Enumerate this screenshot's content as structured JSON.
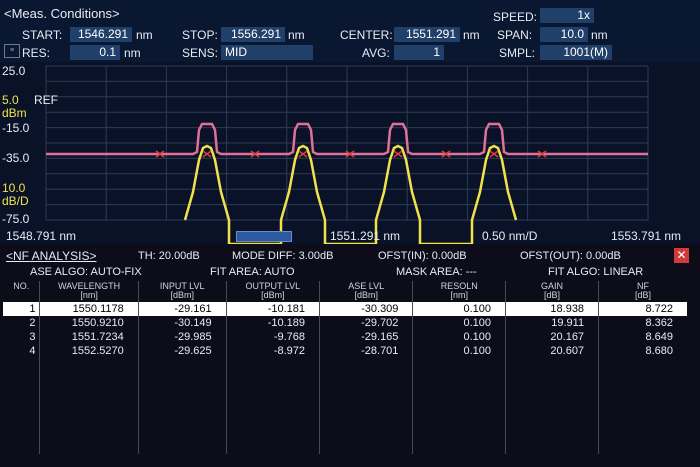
{
  "header": {
    "title": "<Meas. Conditions>",
    "start_label": "START:",
    "start_value": "1546.291",
    "start_unit": "nm",
    "stop_label": "STOP:",
    "stop_value": "1556.291",
    "stop_unit": "nm",
    "center_label": "CENTER:",
    "center_value": "1551.291",
    "center_unit": "nm",
    "speed_label": "SPEED:",
    "speed_value": "1x",
    "res_label": "RES:",
    "res_value": "0.1",
    "res_unit": "nm",
    "sens_label": "SENS:",
    "sens_value": "MID",
    "avg_label": "AVG:",
    "avg_value": "1",
    "span_label": "SPAN:",
    "span_value": "10.0",
    "span_unit": "nm",
    "smpl_label": "SMPL:",
    "smpl_value": "1001(M)"
  },
  "graph": {
    "y_top": "25.0",
    "ref_value": "5.0",
    "ref_label": "REF",
    "ref_unit": "dBm",
    "y_mid1": "-15.0",
    "y_mid2": "-35.0",
    "scale_value": "10.0",
    "scale_unit": "dB/D",
    "y_bottom": "-75.0",
    "x_start": "1548.791 nm",
    "x_center": "1551.291 nm",
    "x_div": "0.50 nm/D",
    "x_stop": "1553.791 nm",
    "colors": {
      "trace_a": "#e0709a",
      "trace_b": "#f2e24a",
      "grid": "#2a3d56",
      "marker": "#e04040"
    }
  },
  "nf": {
    "title": "<NF ANALYSIS>",
    "th": "TH: 20.00dB",
    "mode_diff": "MODE DIFF: 3.00dB",
    "ofst_in": "OFST(IN): 0.00dB",
    "ofst_out": "OFST(OUT): 0.00dB",
    "close_icon": "close-icon",
    "ase_algo": "ASE ALGO: AUTO-FIX",
    "fit_area": "FIT AREA: AUTO",
    "mask_area": "MASK AREA: ---",
    "fit_algo": "FIT ALGO: LINEAR",
    "columns": [
      [
        "NO.",
        ""
      ],
      [
        "WAVELENGTH",
        "[nm]"
      ],
      [
        "INPUT LVL",
        "[dBm]"
      ],
      [
        "OUTPUT LVL",
        "[dBm]"
      ],
      [
        "ASE LVL",
        "[dBm]"
      ],
      [
        "RESOLN",
        "[nm]"
      ],
      [
        "GAIN",
        "[dB]"
      ],
      [
        "NF",
        "[dB]"
      ]
    ],
    "rows": [
      [
        "1",
        "1550.1178",
        "-29.161",
        "-10.181",
        "-30.309",
        "0.100",
        "18.938",
        "8.722"
      ],
      [
        "2",
        "1550.9210",
        "-30.149",
        "-10.189",
        "-29.702",
        "0.100",
        "19.911",
        "8.362"
      ],
      [
        "3",
        "1551.7234",
        "-29.985",
        "-9.768",
        "-29.165",
        "0.100",
        "20.167",
        "8.649"
      ],
      [
        "4",
        "1552.5270",
        "-29.625",
        "-8.972",
        "-28.701",
        "0.100",
        "20.607",
        "8.680"
      ]
    ]
  }
}
